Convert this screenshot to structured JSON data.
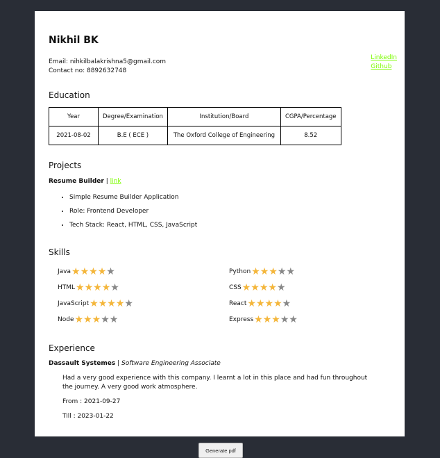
{
  "resume": {
    "name": "Nikhil BK",
    "email": "Email: nihkilbalakrishna5@gmail.com",
    "contact": "Contact no: 8892632748",
    "links": [
      "LinkedIn",
      "Github"
    ],
    "education": {
      "title": "Education",
      "headers": [
        "Year",
        "Degree/Examination",
        "Institution/Board",
        "CGPA/Percentage"
      ],
      "rows": [
        [
          "2021-08-02",
          "B.E ( ECE )",
          "The Oxford College of Engineering",
          "8.52"
        ]
      ]
    },
    "projects": {
      "title": "Projects",
      "name": "Resume Builder",
      "separator": "|",
      "link": "link",
      "bullets": [
        "Simple Resume Builder Application",
        "Role: Frontend Developer",
        "Tech Stack: React, HTML, CSS, JavaScript"
      ]
    },
    "skills": {
      "title": "Skills",
      "items": [
        {
          "name": "Java",
          "rating": 4,
          "max": 5
        },
        {
          "name": "Python",
          "rating": 3,
          "max": 5
        },
        {
          "name": "HTML",
          "rating": 4,
          "max": 5
        },
        {
          "name": "CSS",
          "rating": 4,
          "max": 5
        },
        {
          "name": "JavaScript",
          "rating": 4,
          "max": 5
        },
        {
          "name": "React",
          "rating": 4,
          "max": 5
        },
        {
          "name": "Node",
          "rating": 3,
          "max": 5
        },
        {
          "name": "Express",
          "rating": 3,
          "max": 5
        }
      ]
    },
    "experience": {
      "title": "Experience",
      "company": "Dassault Systemes",
      "separator": "|",
      "role": "Software Engineering Associate",
      "description": "Had a very good experience with this company. I learnt a lot in this place and had fun throughout the journey. A very good work atmosphere.",
      "from": "From : 2021-09-27",
      "till": "Till : 2023-01-22"
    }
  },
  "actions": {
    "generate_label": "Generate pdf"
  },
  "colors": {
    "background": "#292d36",
    "link": "#7CFC00",
    "star_on": "#f4b63b",
    "star_off": "#888888"
  }
}
